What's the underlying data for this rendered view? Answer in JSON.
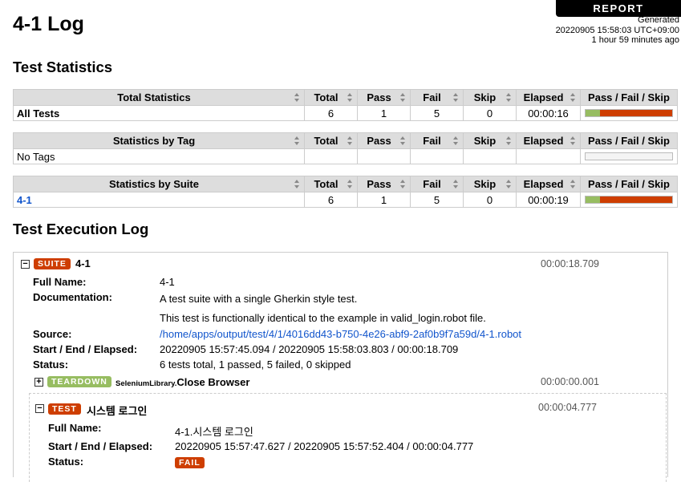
{
  "header": {
    "report_button": "REPORT",
    "generated_label": "Generated",
    "generated_time": "20220905 15:58:03 UTC+09:00",
    "generated_ago": "1 hour 59 minutes ago",
    "title": "4-1 Log"
  },
  "stats_heading": "Test Statistics",
  "columns": {
    "total": "Total",
    "pass": "Pass",
    "fail": "Fail",
    "skip": "Skip",
    "elapsed": "Elapsed",
    "graph": "Pass / Fail / Skip"
  },
  "total_stats": {
    "header": "Total Statistics",
    "row": {
      "name": "All Tests",
      "total": "6",
      "pass": "1",
      "fail": "5",
      "skip": "0",
      "elapsed": "00:00:16",
      "pass_frac": 0.1667,
      "fail_frac": 0.8333
    }
  },
  "tag_stats": {
    "header": "Statistics by Tag",
    "row": {
      "name": "No Tags"
    }
  },
  "suite_stats": {
    "header": "Statistics by Suite",
    "row": {
      "name": "4-1",
      "total": "6",
      "pass": "1",
      "fail": "5",
      "skip": "0",
      "elapsed": "00:00:19",
      "pass_frac": 0.1667,
      "fail_frac": 0.8333
    }
  },
  "log_heading": "Test Execution Log",
  "suite": {
    "toggle": "−",
    "label": "SUITE",
    "name": "4-1",
    "elapsed": "00:00:18.709",
    "fields": {
      "full_name_key": "Full Name:",
      "full_name": "4-1",
      "doc_key": "Documentation:",
      "doc_line1": "A test suite with a single Gherkin style test.",
      "doc_line2": "This test is functionally identical to the example in valid_login.robot file.",
      "source_key": "Source:",
      "source": "/home/apps/output/test/4/1/4016dd43-b750-4e26-abf9-2af0b9f7a59d/4-1.robot",
      "times_key": "Start / End / Elapsed:",
      "times": "20220905 15:57:45.094 / 20220905 15:58:03.803 / 00:00:18.709",
      "status_key": "Status:",
      "status": "6 tests total, 1 passed, 5 failed, 0 skipped"
    },
    "teardown": {
      "toggle": "+",
      "label": "TEARDOWN",
      "library": "SeleniumLibrary.",
      "keyword": "Close Browser",
      "elapsed": "00:00:00.001"
    },
    "test": {
      "toggle": "−",
      "label": "TEST",
      "name": "시스템 로그인",
      "elapsed": "00:00:04.777",
      "full_name_key": "Full Name:",
      "full_name": "4-1.시스템 로그인",
      "times_key": "Start / End / Elapsed:",
      "times": "20220905 15:57:47.627 / 20220905 15:57:52.404 / 00:00:04.777",
      "status_key": "Status:",
      "status": "FAIL"
    }
  },
  "colors": {
    "pass": "#97bd61",
    "fail": "#ce3e01",
    "link": "#1155cc",
    "header_bg": "#dddddd"
  }
}
